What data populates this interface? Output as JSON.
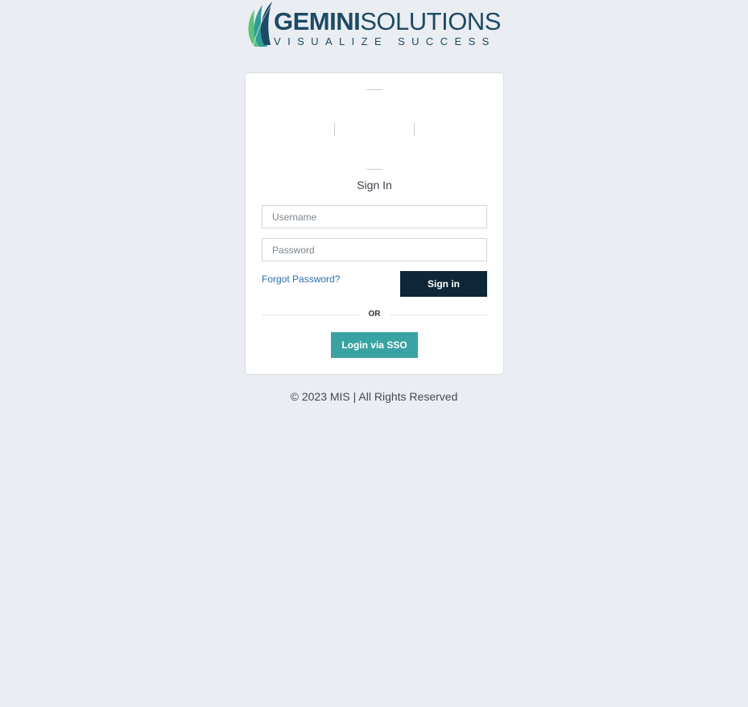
{
  "logo": {
    "brand_bold": "GEMINI",
    "brand_rest": "SOLUTIONS",
    "tagline": "VISUALIZE SUCCESS",
    "icon": "feather-leaf-icon",
    "colors": {
      "navy": "#1d4a66",
      "teal": "#2f9c9a",
      "green": "#5fc27a"
    }
  },
  "login": {
    "avatar_icon": "user-avatar-placeholder-icon",
    "title": "Sign In",
    "username_placeholder": "Username",
    "username_value": "",
    "password_placeholder": "Password",
    "password_value": "",
    "forgot_label": "Forgot Password?",
    "signin_label": "Sign in",
    "or_label": "OR",
    "sso_label": "Login via SSO"
  },
  "footer": {
    "text": "© 2023 MIS | All Rights Reserved"
  },
  "colors": {
    "background": "#eaedf1",
    "signin_button": "#0e2637",
    "sso_button": "#39a3a3",
    "link": "#2a6fb0"
  }
}
